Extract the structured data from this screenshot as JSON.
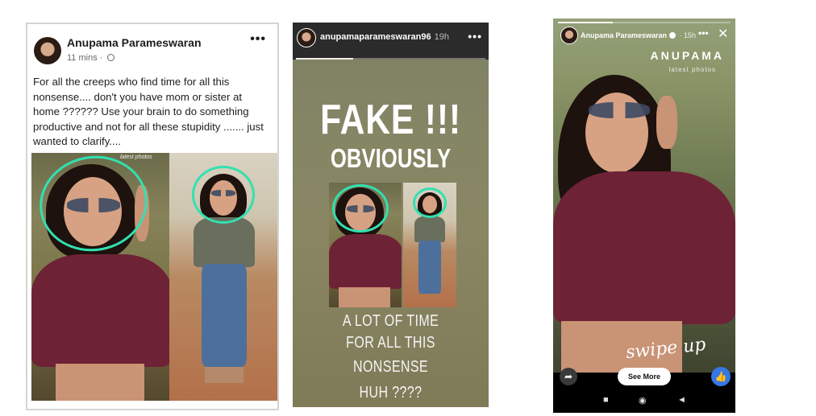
{
  "facebook_post": {
    "author": "Anupama Parameswaran",
    "time": "11 mins",
    "visibility_icon": "globe-icon",
    "more_icon": "more-dots-icon",
    "text": "For all the creeps who find time for all this nonsense.... don't you have mom or sister at home ?????? Use your brain to do something productive and not for all these stupidity ....... just wanted to clarify....",
    "photo_tag": "latest photos",
    "highlight_color": "#32e0b0"
  },
  "story_fake": {
    "username": "anupamaparameswaran96",
    "time": "19h",
    "headline": "FAKE !!!",
    "subheadline": "OBVIOUSLY",
    "lines": [
      "A LOT OF TIME",
      "FOR ALL THIS",
      "NONSENSE",
      "HUH ????"
    ]
  },
  "story_mobile": {
    "username": "Anupama Parameswaran",
    "time": "15h",
    "brand": "ANUPAMA",
    "brand_sub": "latest photos",
    "swipe_text": "swipe up",
    "see_more": "See More",
    "share_icon": "share-arrow-icon",
    "like_icon": "thumbs-up-icon",
    "like_color": "#3578e5",
    "nav": {
      "square": "■",
      "circle": "◉",
      "back": "◄"
    }
  }
}
